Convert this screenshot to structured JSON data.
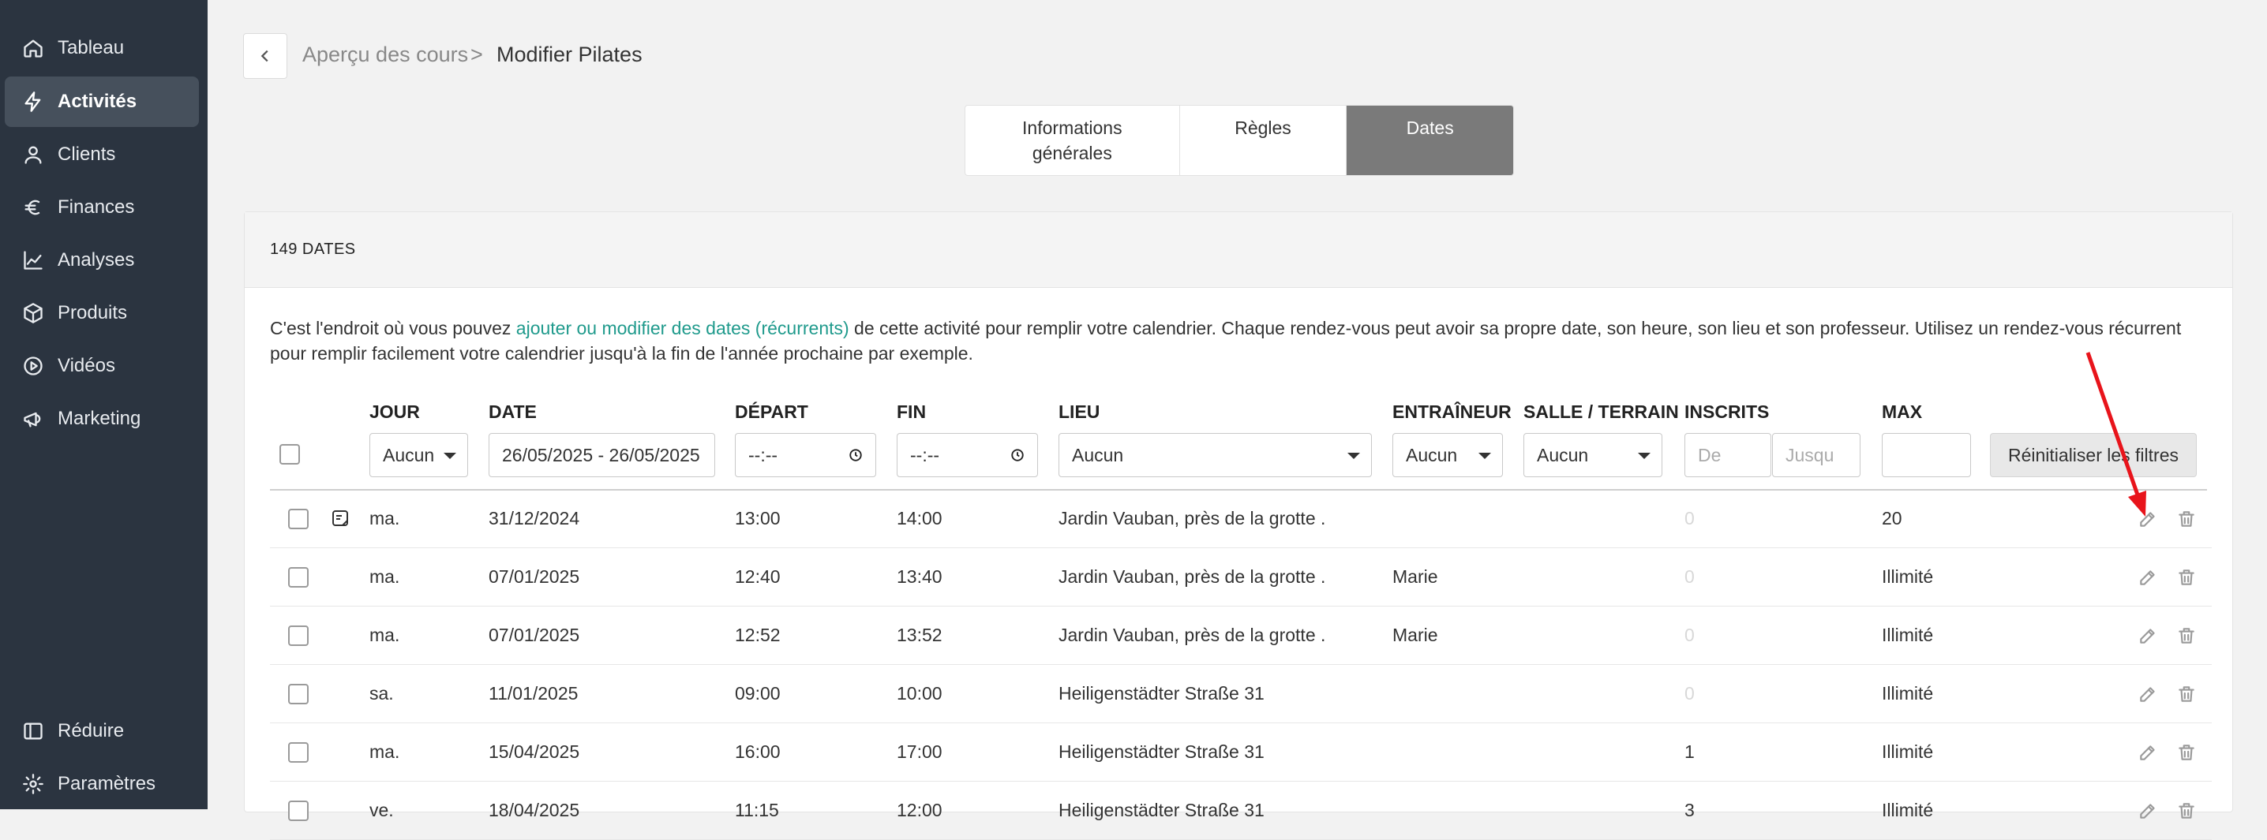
{
  "sidebar": {
    "items": [
      {
        "label": "Tableau",
        "icon": "home-icon"
      },
      {
        "label": "Activités",
        "icon": "bolt-icon",
        "active": true
      },
      {
        "label": "Clients",
        "icon": "user-icon"
      },
      {
        "label": "Finances",
        "icon": "euro-icon"
      },
      {
        "label": "Analyses",
        "icon": "chart-line-icon"
      },
      {
        "label": "Produits",
        "icon": "box-icon"
      },
      {
        "label": "Vidéos",
        "icon": "play-circle-icon"
      },
      {
        "label": "Marketing",
        "icon": "megaphone-icon"
      }
    ],
    "bottom": [
      {
        "label": "Réduire",
        "icon": "collapse-icon"
      },
      {
        "label": "Paramètres",
        "icon": "gear-icon"
      }
    ]
  },
  "breadcrumb": {
    "previous": "Aperçu des cours",
    "separator": ">",
    "current": "Modifier Pilates"
  },
  "tabs": [
    {
      "label": "Informations générales"
    },
    {
      "label": "Règles"
    },
    {
      "label": "Dates",
      "active": true
    }
  ],
  "card": {
    "count_label": "149 DATES",
    "intro_before": "C'est l'endroit où vous pouvez ",
    "intro_link": "ajouter ou modifier des dates (récurrents)",
    "intro_after": " de cette activité pour remplir votre calendrier. Chaque rendez-vous peut avoir sa propre date, son heure, son lieu et son professeur. Utilisez un rendez-vous récurrent pour remplir facilement votre calendrier jusqu'à la fin de l'année prochaine par exemple."
  },
  "columns": {
    "jour": "JOUR",
    "date": "DATE",
    "depart": "DÉPART",
    "fin": "FIN",
    "lieu": "LIEU",
    "entraineur": "ENTRAÎNEUR",
    "salle": "SALLE / TERRAIN",
    "inscrits": "INSCRITS",
    "max": "MAX"
  },
  "filters": {
    "jour": "Aucun",
    "date": "26/05/2025 - 26/05/2025",
    "depart": "--:--",
    "fin": "--:--",
    "lieu": "Aucun",
    "entraineur": "Aucun",
    "salle": "Aucun",
    "inscrits_from_placeholder": "De",
    "inscrits_to_placeholder": "Jusqu",
    "max": "",
    "reset_label": "Réinitialiser les filtres"
  },
  "rows": [
    {
      "jour": "ma.",
      "date": "31/12/2024",
      "depart": "13:00",
      "fin": "14:00",
      "lieu": "Jardin Vauban, près de la grotte .",
      "entraineur": "",
      "salle": "",
      "inscrits": "0",
      "max": "20",
      "note": true
    },
    {
      "jour": "ma.",
      "date": "07/01/2025",
      "depart": "12:40",
      "fin": "13:40",
      "lieu": "Jardin Vauban, près de la grotte .",
      "entraineur": "Marie",
      "salle": "",
      "inscrits": "0",
      "max": "Illimité"
    },
    {
      "jour": "ma.",
      "date": "07/01/2025",
      "depart": "12:52",
      "fin": "13:52",
      "lieu": "Jardin Vauban, près de la grotte .",
      "entraineur": "Marie",
      "salle": "",
      "inscrits": "0",
      "max": "Illimité"
    },
    {
      "jour": "sa.",
      "date": "11/01/2025",
      "depart": "09:00",
      "fin": "10:00",
      "lieu": "Heiligenstädter Straße 31",
      "entraineur": "",
      "salle": "",
      "inscrits": "0",
      "max": "Illimité"
    },
    {
      "jour": "ma.",
      "date": "15/04/2025",
      "depart": "16:00",
      "fin": "17:00",
      "lieu": "Heiligenstädter Straße 31",
      "entraineur": "",
      "salle": "",
      "inscrits": "1",
      "max": "Illimité"
    },
    {
      "jour": "ve.",
      "date": "18/04/2025",
      "depart": "11:15",
      "fin": "12:00",
      "lieu": "Heiligenstädter Straße 31",
      "entraineur": "",
      "salle": "",
      "inscrits": "3",
      "max": "Illimité"
    }
  ],
  "colors": {
    "sidebar": "#2b3440",
    "sidebar_active": "#46505c",
    "accent_link": "#1f9a8c",
    "tab_active": "#7a7a7a",
    "annotation_arrow": "#e8141b"
  }
}
